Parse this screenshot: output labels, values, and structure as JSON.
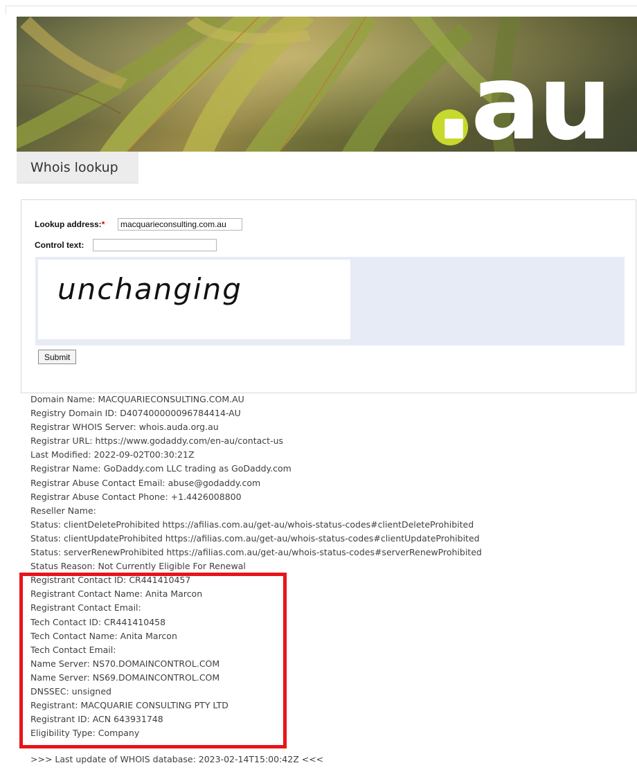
{
  "banner": {
    "domain_text": ".au",
    "accent_color": "#c6d92c"
  },
  "tab": {
    "title": "Whois lookup"
  },
  "form": {
    "lookup_label": "Lookup address:",
    "required_marker": "*",
    "lookup_value": "macquarieconsulting.com.au",
    "control_label": "Control text:",
    "control_value": "",
    "captcha_text": "unchanging",
    "submit_label": "Submit"
  },
  "whois": {
    "lines": [
      "Domain Name: MACQUARIECONSULTING.COM.AU",
      "Registry Domain ID: D407400000096784414-AU",
      "Registrar WHOIS Server: whois.auda.org.au",
      "Registrar URL: https://www.godaddy.com/en-au/contact-us",
      "Last Modified: 2022-09-02T00:30:21Z",
      "Registrar Name: GoDaddy.com LLC trading as GoDaddy.com",
      "Registrar Abuse Contact Email: abuse@godaddy.com",
      "Registrar Abuse Contact Phone: +1.4426008800",
      "Reseller Name:",
      "Status: clientDeleteProhibited https://afilias.com.au/get-au/whois-status-codes#clientDeleteProhibited",
      "Status: clientUpdateProhibited https://afilias.com.au/get-au/whois-status-codes#clientUpdateProhibited",
      "Status: serverRenewProhibited https://afilias.com.au/get-au/whois-status-codes#serverRenewProhibited",
      "Status Reason: Not Currently Eligible For Renewal",
      "Registrant Contact ID: CR441410457",
      "Registrant Contact Name: Anita Marcon",
      "Registrant Contact Email:",
      "Tech Contact ID: CR441410458",
      "Tech Contact Name: Anita Marcon",
      "Tech Contact Email:",
      "Name Server: NS70.DOMAINCONTROL.COM",
      "Name Server: NS69.DOMAINCONTROL.COM",
      "DNSSEC: unsigned",
      "Registrant: MACQUARIE CONSULTING PTY LTD",
      "Registrant ID: ACN 643931748",
      "Eligibility Type: Company"
    ],
    "footer": ">>> Last update of WHOIS database: 2023-02-14T15:00:42Z <<<"
  },
  "colors": {
    "highlight_border": "#e8141a",
    "captcha_bg": "#e7ebf5",
    "tab_bg": "#ececec"
  }
}
